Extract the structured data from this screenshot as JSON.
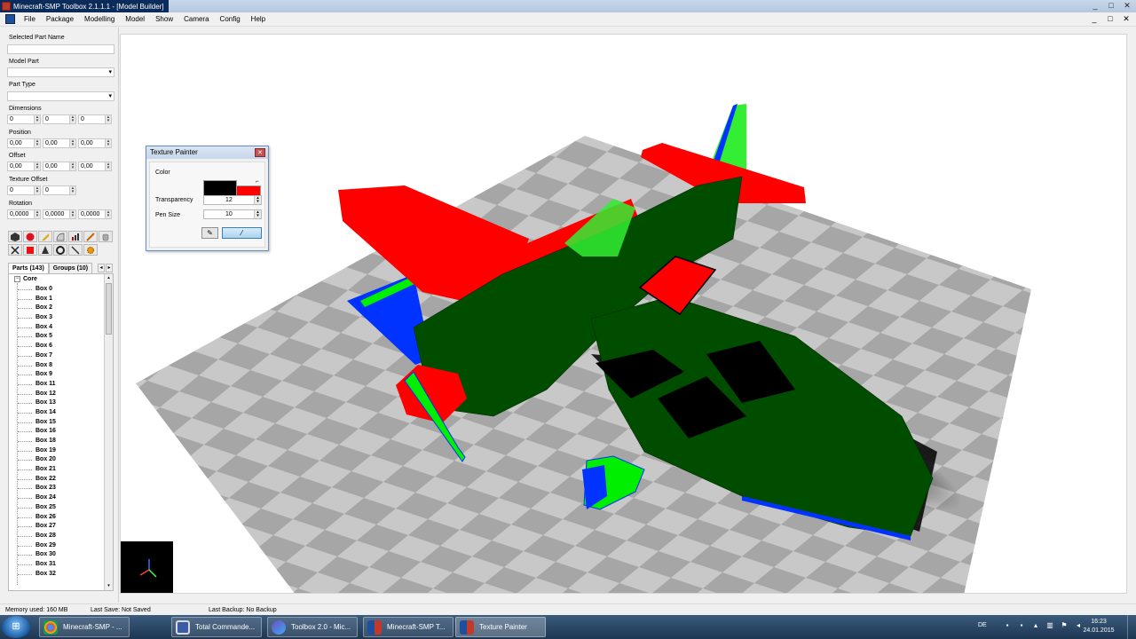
{
  "window": {
    "title": "Minecraft-SMP Toolbox 2.1.1.1 - [Model Builder]",
    "controls": [
      "_",
      "□",
      "✕"
    ],
    "child_controls": [
      "_",
      "□",
      "✕"
    ]
  },
  "menu": [
    "File",
    "Package",
    "Modelling",
    "Model",
    "Show",
    "Camera",
    "Config",
    "Help"
  ],
  "left_panel": {
    "selected_part_name_label": "Selected Part Name",
    "selected_part_name_value": "",
    "model_part_label": "Model Part",
    "model_part_value": "",
    "part_type_label": "Part Type",
    "part_type_value": "",
    "dimensions_label": "Dimensions",
    "dimensions": [
      "0",
      "0",
      "0"
    ],
    "position_label": "Position",
    "position": [
      "0,00",
      "0,00",
      "0,00"
    ],
    "offset_label": "Offset",
    "offset": [
      "0,00",
      "0,00",
      "0,00"
    ],
    "texture_offset_label": "Texture Offset",
    "texture_offset": [
      "0",
      "0"
    ],
    "rotation_label": "Rotation",
    "rotation": [
      "0,0000",
      "0,0000",
      "0,0000"
    ],
    "tool_icons_row1": [
      "cube-icon",
      "sphere-icon",
      "paint-icon",
      "shape-icon",
      "chart-icon",
      "brush-icon",
      "cylinder-icon"
    ],
    "tool_icons_row2": [
      "delete-icon",
      "red-box-icon",
      "cone-icon",
      "ring-icon",
      "pick-icon",
      "gear-icon"
    ],
    "tabs": [
      "Parts (143)",
      "Groups (10)"
    ],
    "tree_root": "Core",
    "tree_items": [
      "Box 0",
      "Box 1",
      "Box 2",
      "Box 3",
      "Box 4",
      "Box 5",
      "Box 6",
      "Box 7",
      "Box 8",
      "Box 9",
      "Box 11",
      "Box 12",
      "Box 13",
      "Box 14",
      "Box 15",
      "Box 16",
      "Box 18",
      "Box 19",
      "Box 20",
      "Box 21",
      "Box 22",
      "Box 23",
      "Box 24",
      "Box 25",
      "Box 26",
      "Box 27",
      "Box 28",
      "Box 29",
      "Box 30",
      "Box 31",
      "Box 32"
    ]
  },
  "texture_painter": {
    "title": "Texture Painter",
    "color_label": "Color",
    "primary_color": "#000000",
    "secondary_color": "#ff0000",
    "transparency_label": "Transparency",
    "transparency_value": "12",
    "pen_size_label": "Pen Size",
    "pen_size_value": "10"
  },
  "status": {
    "memory": "Memory used: 160 MB",
    "last_save": "Last Save: Not Saved",
    "last_backup": "Last Backup: No Backup"
  },
  "taskbar": {
    "items": [
      {
        "label": "Minecraft-SMP - ...",
        "icon": "chrome-icon"
      },
      {
        "label": "Total Commande...",
        "icon": "floppy-icon"
      },
      {
        "label": "Toolbox 2.0 - Mic...",
        "icon": "media-icon"
      },
      {
        "label": "Minecraft-SMP T...",
        "icon": "toolbox-icon"
      },
      {
        "label": "Texture Painter",
        "icon": "toolbox-icon"
      }
    ],
    "lang": "DE",
    "time": "16:23",
    "date": "24.01.2015"
  }
}
